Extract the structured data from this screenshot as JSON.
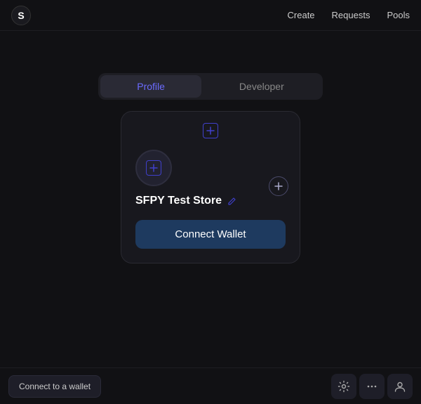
{
  "nav": {
    "logo_text": "S",
    "links": [
      {
        "label": "Create",
        "id": "create"
      },
      {
        "label": "Requests",
        "id": "requests"
      },
      {
        "label": "Pools",
        "id": "pools"
      }
    ]
  },
  "tabs": [
    {
      "label": "Profile",
      "id": "profile",
      "active": true
    },
    {
      "label": "Developer",
      "id": "developer",
      "active": false
    }
  ],
  "profile_card": {
    "store_name": "SFPY Test Store",
    "connect_wallet_label": "Connect Wallet"
  },
  "bottom_bar": {
    "connect_wallet_label": "Connect to a wallet"
  }
}
